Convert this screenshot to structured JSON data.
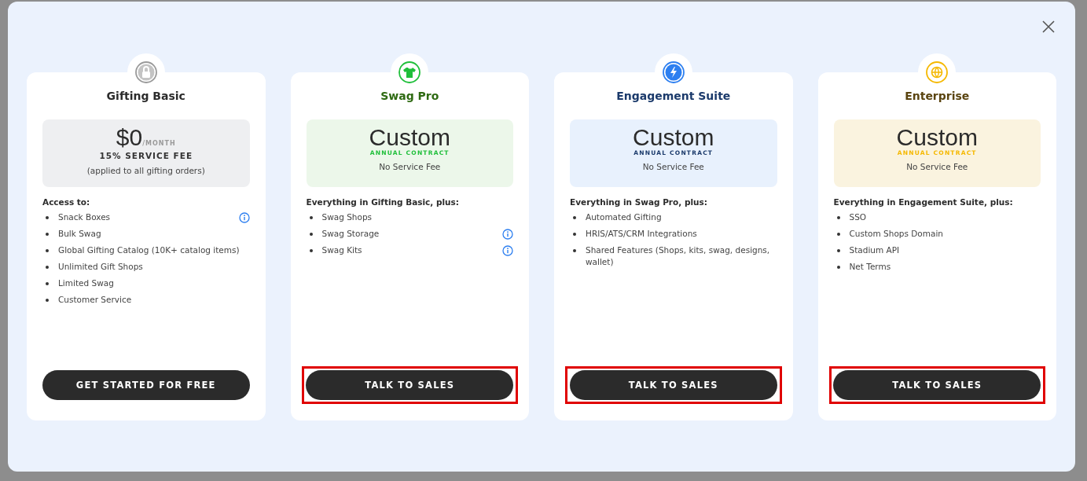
{
  "plans": [
    {
      "name": "Gifting Basic",
      "price": "$0",
      "period": "/MONTH",
      "contract": "15% SERVICE FEE",
      "note": "(applied to all gifting orders)",
      "kind": "free",
      "features_heading": "Access to:",
      "features": [
        {
          "text": "Snack Boxes",
          "info": true
        },
        {
          "text": "Bulk Swag",
          "info": false
        },
        {
          "text": "Global Gifting Catalog (10K+ catalog items)",
          "info": false
        },
        {
          "text": "Unlimited Gift Shops",
          "info": false
        },
        {
          "text": "Limited Swag",
          "info": false
        },
        {
          "text": "Customer Service",
          "info": false
        }
      ],
      "button": {
        "label": "GET STARTED FOR FREE",
        "highlighted": false
      }
    },
    {
      "name": "Swag Pro",
      "price": "Custom",
      "contract": "ANNUAL CONTRACT",
      "note": "No Service Fee",
      "kind": "custom",
      "features_heading": "Everything in Gifting Basic, plus:",
      "features": [
        {
          "text": "Swag Shops",
          "info": false
        },
        {
          "text": "Swag Storage",
          "info": true
        },
        {
          "text": "Swag Kits",
          "info": true
        }
      ],
      "button": {
        "label": "TALK TO SALES",
        "highlighted": true
      }
    },
    {
      "name": "Engagement Suite",
      "price": "Custom",
      "contract": "ANNUAL CONTRACT",
      "note": "No Service Fee",
      "kind": "custom",
      "features_heading": "Everything in Swag Pro, plus:",
      "features": [
        {
          "text": "Automated Gifting",
          "info": false
        },
        {
          "text": "HRIS/ATS/CRM Integrations",
          "info": false
        },
        {
          "text": "Shared Features (Shops, kits, swag, designs, wallet)",
          "info": false
        }
      ],
      "button": {
        "label": "TALK TO SALES",
        "highlighted": true
      }
    },
    {
      "name": "Enterprise",
      "price": "Custom",
      "contract": "ANNUAL CONTRACT",
      "note": "No Service Fee",
      "kind": "custom",
      "features_heading": "Everything in Engagement Suite, plus:",
      "features": [
        {
          "text": "SSO",
          "info": false
        },
        {
          "text": "Custom Shops Domain",
          "info": false
        },
        {
          "text": "Stadium API",
          "info": false
        },
        {
          "text": "Net Terms",
          "info": false
        }
      ],
      "button": {
        "label": "TALK TO SALES",
        "highlighted": true
      }
    }
  ]
}
